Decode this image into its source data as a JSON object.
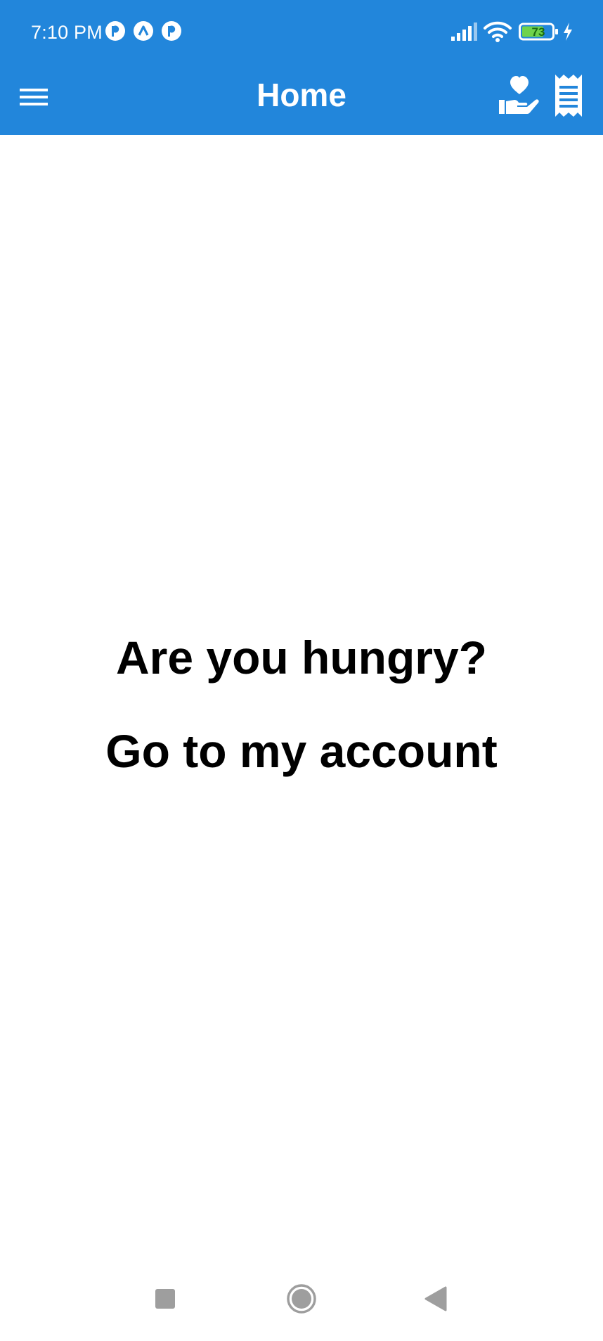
{
  "status_bar": {
    "time": "7:10 PM",
    "battery_level": "73",
    "notification_icons": [
      "pocket-casts-icon",
      "artifact-icon",
      "pocket-casts-icon"
    ],
    "system_icons": [
      "signal-icon",
      "wifi-icon",
      "battery-icon",
      "charging-icon"
    ]
  },
  "toolbar": {
    "title": "Home",
    "menu_icon": "hamburger-menu-icon",
    "actions": [
      "donate-hand-heart-icon",
      "receipt-icon"
    ]
  },
  "main": {
    "heading": "Are you hungry?",
    "account_link": "Go to my account"
  },
  "nav_bar": {
    "buttons": [
      "recents-square-icon",
      "home-circle-icon",
      "back-triangle-icon"
    ]
  },
  "colors": {
    "appbar": "#2286db",
    "text": "#000000",
    "battery_fill": "#6fd34b"
  }
}
